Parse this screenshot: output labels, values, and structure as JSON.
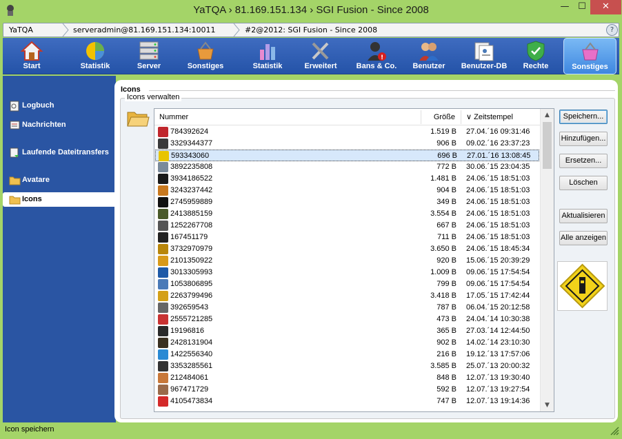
{
  "window": {
    "title": "YaTQA › 81.169.151.134 › SGI Fusion - Since 2008",
    "min": "—",
    "max": "☐",
    "close": "✕"
  },
  "breadcrumb": {
    "items": [
      "YaTQA",
      "serveradmin@81.169.151.134:10011",
      "#2@2012: SGI Fusion - Since 2008"
    ],
    "help": "?"
  },
  "toolbar": {
    "items": [
      {
        "label": "Start",
        "icon": "house-icon"
      },
      {
        "label": "Statistik",
        "icon": "pie-chart-icon"
      },
      {
        "label": "Server",
        "icon": "server-icon"
      },
      {
        "label": "Sonstiges",
        "icon": "basket-icon"
      },
      {
        "label": "Statistik",
        "icon": "bar-chart-icon"
      },
      {
        "label": "Erweitert",
        "icon": "tools-icon"
      },
      {
        "label": "Bans & Co.",
        "icon": "ban-user-icon"
      },
      {
        "label": "Benutzer",
        "icon": "users-icon"
      },
      {
        "label": "Benutzer-DB",
        "icon": "user-db-icon"
      },
      {
        "label": "Rechte",
        "icon": "shield-icon"
      },
      {
        "label": "Sonstiges",
        "icon": "basket-icon"
      }
    ],
    "active_index": 10
  },
  "sidebar": {
    "items": [
      {
        "label": "Logbuch",
        "icon": "log-icon"
      },
      {
        "label": "Nachrichten",
        "icon": "messages-icon"
      },
      {
        "label": "Laufende Dateitransfers",
        "icon": "transfer-icon"
      },
      {
        "label": "Avatare",
        "icon": "folder-icon"
      },
      {
        "label": "Icons",
        "icon": "folder-icon"
      }
    ],
    "selected_index": 4
  },
  "section": {
    "title": "Icons",
    "group_label": "Icons verwalten"
  },
  "table": {
    "columns": [
      "Nummer",
      "Größe",
      "∨ Zeitstempel"
    ],
    "rows": [
      {
        "num": "784392624",
        "size": "1.519 B",
        "time": "27.04.´16 09:31:46",
        "color": "#c0262c"
      },
      {
        "num": "3329344377",
        "size": "906 B",
        "time": "09.02.´16 23:37:23",
        "color": "#3a3a3a"
      },
      {
        "num": "593343060",
        "size": "696 B",
        "time": "27.01.´16 13:08:45",
        "color": "#e8c400"
      },
      {
        "num": "3892235808",
        "size": "772 B",
        "time": "30.06.´15 23:04:35",
        "color": "#7a8a9a"
      },
      {
        "num": "3934186522",
        "size": "1.481 B",
        "time": "24.06.´15 18:51:03",
        "color": "#1a1a1a"
      },
      {
        "num": "3243237442",
        "size": "904 B",
        "time": "24.06.´15 18:51:03",
        "color": "#c8781e"
      },
      {
        "num": "2745959889",
        "size": "349 B",
        "time": "24.06.´15 18:51:03",
        "color": "#111111"
      },
      {
        "num": "2413885159",
        "size": "3.554 B",
        "time": "24.06.´15 18:51:03",
        "color": "#4a5a2a"
      },
      {
        "num": "1252267708",
        "size": "667 B",
        "time": "24.06.´15 18:51:03",
        "color": "#555555"
      },
      {
        "num": "167451179",
        "size": "711 B",
        "time": "24.06.´15 18:51:03",
        "color": "#222222"
      },
      {
        "num": "3732970979",
        "size": "3.650 B",
        "time": "24.06.´15 18:45:34",
        "color": "#b8860b"
      },
      {
        "num": "2101350922",
        "size": "920 B",
        "time": "15.06.´15 20:39:29",
        "color": "#d89a1a"
      },
      {
        "num": "3013305993",
        "size": "1.009 B",
        "time": "09.06.´15 17:54:54",
        "color": "#1e5aa8"
      },
      {
        "num": "1053806895",
        "size": "799 B",
        "time": "09.06.´15 17:54:54",
        "color": "#4a7ab8"
      },
      {
        "num": "2263799496",
        "size": "3.418 B",
        "time": "17.05.´15 17:42:44",
        "color": "#d4a017"
      },
      {
        "num": "392659543",
        "size": "787 B",
        "time": "06.04.´15 20:12:58",
        "color": "#666666"
      },
      {
        "num": "2555721285",
        "size": "473 B",
        "time": "24.04.´14 10:30:38",
        "color": "#c83232"
      },
      {
        "num": "19196816",
        "size": "365 B",
        "time": "27.03.´14 12:44:50",
        "color": "#2a2a2a"
      },
      {
        "num": "2428131904",
        "size": "902 B",
        "time": "14.02.´14 23:10:30",
        "color": "#3a3020"
      },
      {
        "num": "1422556340",
        "size": "216 B",
        "time": "19.12.´13 17:57:06",
        "color": "#2a8ad4"
      },
      {
        "num": "3353285561",
        "size": "3.585 B",
        "time": "25.07.´13 20:00:32",
        "color": "#333333"
      },
      {
        "num": "212484061",
        "size": "848 B",
        "time": "12.07.´13 19:30:40",
        "color": "#c8783a"
      },
      {
        "num": "967471729",
        "size": "592 B",
        "time": "12.07.´13 19:27:54",
        "color": "#9a6a4a"
      },
      {
        "num": "4105473834",
        "size": "747 B",
        "time": "12.07.´13 19:14:36",
        "color": "#d42a2a"
      }
    ],
    "selected_index": 2
  },
  "actions": {
    "save": "Speichern...",
    "add": "Hinzufügen...",
    "replace": "Ersetzen...",
    "delete": "Löschen",
    "refresh": "Aktualisieren",
    "show_all": "Alle anzeigen"
  },
  "status": {
    "text": "Icon speichern"
  }
}
